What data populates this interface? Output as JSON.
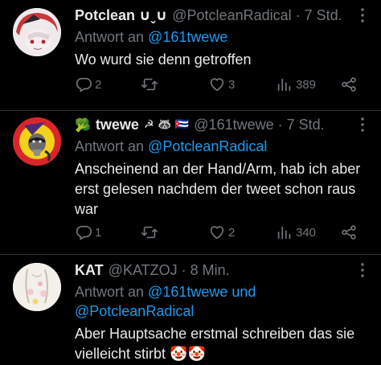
{
  "tweets": [
    {
      "name": "Potclean ∪ˬ∪",
      "handle": "@PotcleanRadical",
      "dot": "·",
      "time": "7 Std.",
      "reply_prefix": "Antwort an ",
      "reply_to": "@161twewe",
      "text": "Wo wurd sie denn getroffen",
      "replies": "2",
      "retweets": "",
      "likes": "3",
      "views": "389"
    },
    {
      "name_prefix": "🥦",
      "name": "twewe",
      "name_suffix": "☭ 🦝 🇨🇺",
      "handle": "@161twewe",
      "dot": "·",
      "time": "7 Std.",
      "reply_prefix": "Antwort an ",
      "reply_to": "@PotcleanRadical",
      "text": "Anscheinend an der Hand/Arm, hab ich aber erst gelesen nachdem der tweet schon raus war",
      "replies": "1",
      "retweets": "",
      "likes": "2",
      "views": "340"
    },
    {
      "name": "KAT",
      "handle": "@KATZOJ",
      "dot": "·",
      "time": "8 Min.",
      "reply_prefix": "Antwort an ",
      "reply_to": "@161twewe",
      "reply_and": " und",
      "reply_to_2": "@PotcleanRadical",
      "text": "Aber Hauptsache erstmal schreiben das sie vielleicht stirbt 🤡🤡"
    }
  ],
  "icons": {
    "reply": "reply-icon",
    "retweet": "retweet-icon",
    "like": "like-icon",
    "views": "views-icon",
    "share": "share-icon",
    "more": "more-icon"
  },
  "colors": {
    "background": "#000000",
    "text": "#e7e9ea",
    "muted": "#71767b",
    "link": "#1d9bf0",
    "divider": "#2f3336"
  }
}
